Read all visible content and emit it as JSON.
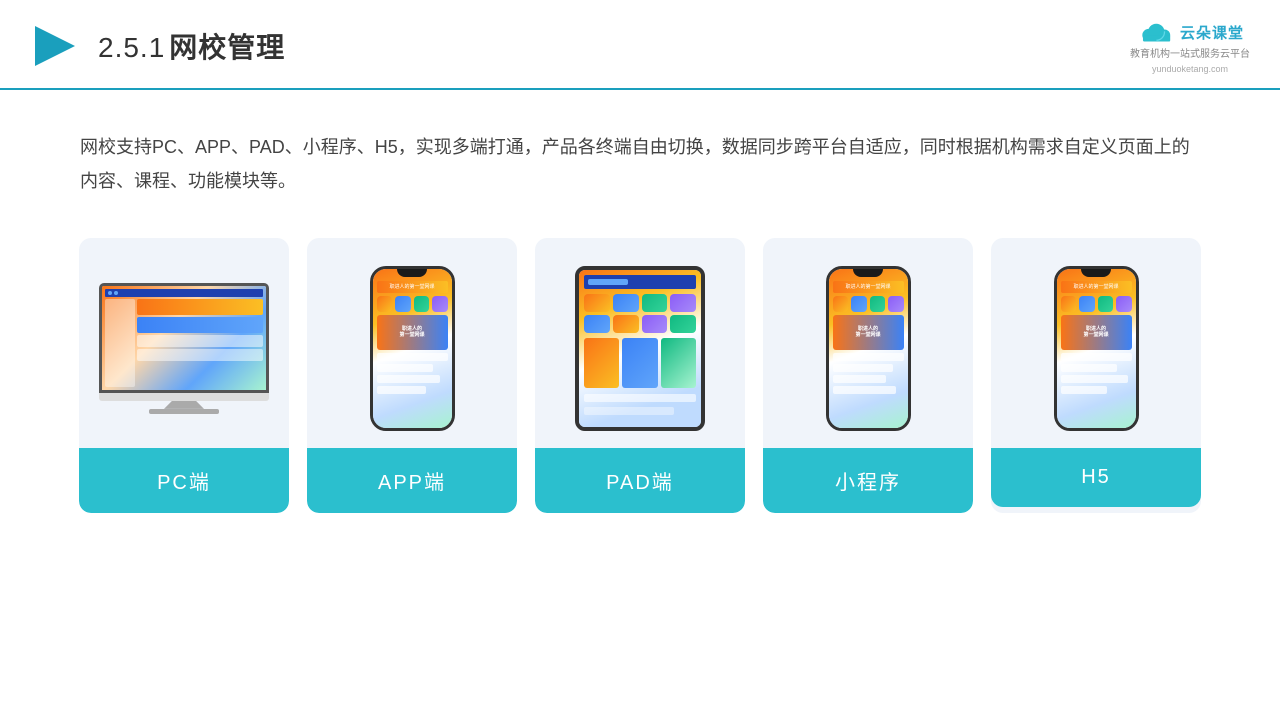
{
  "header": {
    "section_number": "2.5.1",
    "title": "网校管理",
    "logo_name": "云朵课堂",
    "logo_url": "yunduoketang.com",
    "logo_tagline": "教育机构一站\n式服务云平台"
  },
  "description": {
    "text": "网校支持PC、APP、PAD、小程序、H5，实现多端打通，产品各终端自由切换，数据同步跨平台自适应，同时根据机构需求自定义页面上的内容、课程、功能模块等。"
  },
  "cards": [
    {
      "id": "pc",
      "label": "PC端",
      "device": "monitor"
    },
    {
      "id": "app",
      "label": "APP端",
      "device": "phone"
    },
    {
      "id": "pad",
      "label": "PAD端",
      "device": "tablet"
    },
    {
      "id": "miniprogram",
      "label": "小程序",
      "device": "phone"
    },
    {
      "id": "h5",
      "label": "H5",
      "device": "phone"
    }
  ],
  "colors": {
    "accent": "#2bbfce",
    "header_border": "#1a9fbd",
    "card_bg": "#eef2f9",
    "text_dark": "#333",
    "text_body": "#444"
  }
}
